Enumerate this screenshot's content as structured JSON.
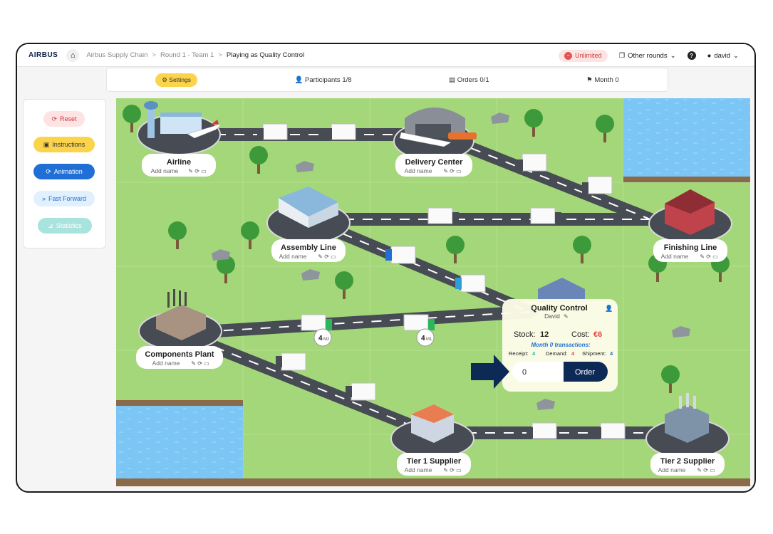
{
  "topbar": {
    "logo": "AIRBUS",
    "breadcrumb": [
      "Airbus Supply Chain",
      "Round 1 - Team 1",
      "Playing as Quality Control"
    ],
    "separator": ">",
    "unlimited_label": "Unlimited",
    "other_rounds_label": "Other rounds",
    "help_label": "?",
    "user_label": "david"
  },
  "subbar": {
    "settings_label": "Settings",
    "participants_label": "Participants 1/8",
    "orders_label": "Orders 0/1",
    "month_label": "Month 0"
  },
  "sidebar": {
    "reset_label": "Reset",
    "instructions_label": "Instructions",
    "animation_label": "Animation",
    "fast_forward_label": "Fast Forward",
    "statistics_label": "Statistics"
  },
  "nodes": {
    "airline": {
      "name": "Airline",
      "sub": "Add name"
    },
    "delivery_center": {
      "name": "Delivery Center",
      "sub": "Add name"
    },
    "assembly_line": {
      "name": "Assembly Line",
      "sub": "Add name"
    },
    "finishing_line": {
      "name": "Finishing Line",
      "sub": "Add name"
    },
    "components_plant": {
      "name": "Components Plant",
      "sub": "Add name"
    },
    "tier1_supplier": {
      "name": "Tier 1 Supplier",
      "sub": "Add name"
    },
    "tier2_supplier": {
      "name": "Tier 2 Supplier",
      "sub": "Add name"
    }
  },
  "truck_badges": [
    {
      "count": "4",
      "month": "M2"
    },
    {
      "count": "4",
      "month": "M1"
    }
  ],
  "qc_card": {
    "title": "Quality Control",
    "player": "David",
    "stock_label": "Stock:",
    "stock_value": "12",
    "cost_label": "Cost:",
    "cost_value": "€6",
    "transactions_title": "Month 0 transactions:",
    "receipt_label": "Receipt:",
    "receipt_value": "4",
    "demand_label": "Demand:",
    "demand_value": "4",
    "shipment_label": "Shipment:",
    "shipment_value": "4",
    "order_input_value": "0",
    "order_button_label": "Order"
  },
  "colors": {
    "grass": "#a4d77a",
    "road": "#474b53",
    "water": "#7cc6f5",
    "cost_red": "#e84545",
    "receipt_teal": "#2bb5a8",
    "demand_red": "#e84545",
    "shipment_blue": "#1f6fd6",
    "order_navy": "#0d2a57"
  }
}
